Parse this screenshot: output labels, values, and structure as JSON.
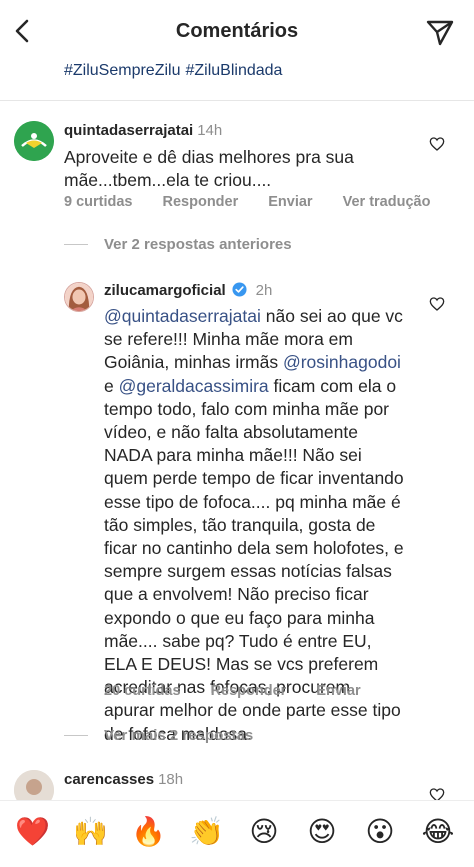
{
  "header": {
    "title": "Comentários",
    "back_icon": "chevron-left-icon",
    "send_icon": "paper-plane-icon"
  },
  "hashtags": [
    "#ZiluSempreZilu",
    "#ZiluBlindada"
  ],
  "comment1": {
    "username": "quintadaserrajatai",
    "time": "14h",
    "text": "Aproveite e dê dias melhores pra sua mãe...tbem...ela te criou....",
    "likes": "9 curtidas",
    "reply": "Responder",
    "send": "Enviar",
    "translate": "Ver tradução"
  },
  "view_previous": "Ver 2 respostas anteriores",
  "reply1": {
    "username": "zilucamargoficial",
    "time": "2h",
    "verified": true,
    "mention1": "@quintadaserrajatai",
    "text1": " não sei ao que vc se refere!!! Minha mãe mora em Goiânia, minhas irmãs ",
    "mention2": "@rosinhagodoi",
    "text2": " e ",
    "mention3": "@geraldacassimira",
    "text3": " ficam com ela o tempo todo, falo com minha mãe por vídeo, e não falta absolutamente NADA para minha mãe!!! Não sei quem perde tempo de ficar inventando esse tipo de fofoca.... pq minha mãe é tão simples, tão tranquila, gosta de ficar no cantinho dela sem holofotes, e sempre surgem essas notícias falsas que a envolvem! Não preciso ficar expondo o que eu faço para minha mãe.... sabe pq? Tudo é entre EU, ELA E DEUS! Mas se vcs preferem acreditar nas fofocas, procurem apurar melhor de onde parte esse tipo de fofoca maldosa.",
    "likes": "20 curtidas",
    "reply": "Responder",
    "send": "Enviar"
  },
  "view_more": "Ver mais 2 respostas",
  "comment2": {
    "username": "carencasses",
    "time": "18h"
  },
  "emoji_bar": [
    "❤️",
    "🙌",
    "🔥",
    "👏",
    "😢",
    "😍",
    "😮",
    "😂"
  ],
  "colors": {
    "text": "#262626",
    "secondary": "#8e8e8e",
    "mention": "#385185",
    "verified": "#3897f0",
    "hashtag": "#1b3a6b"
  }
}
